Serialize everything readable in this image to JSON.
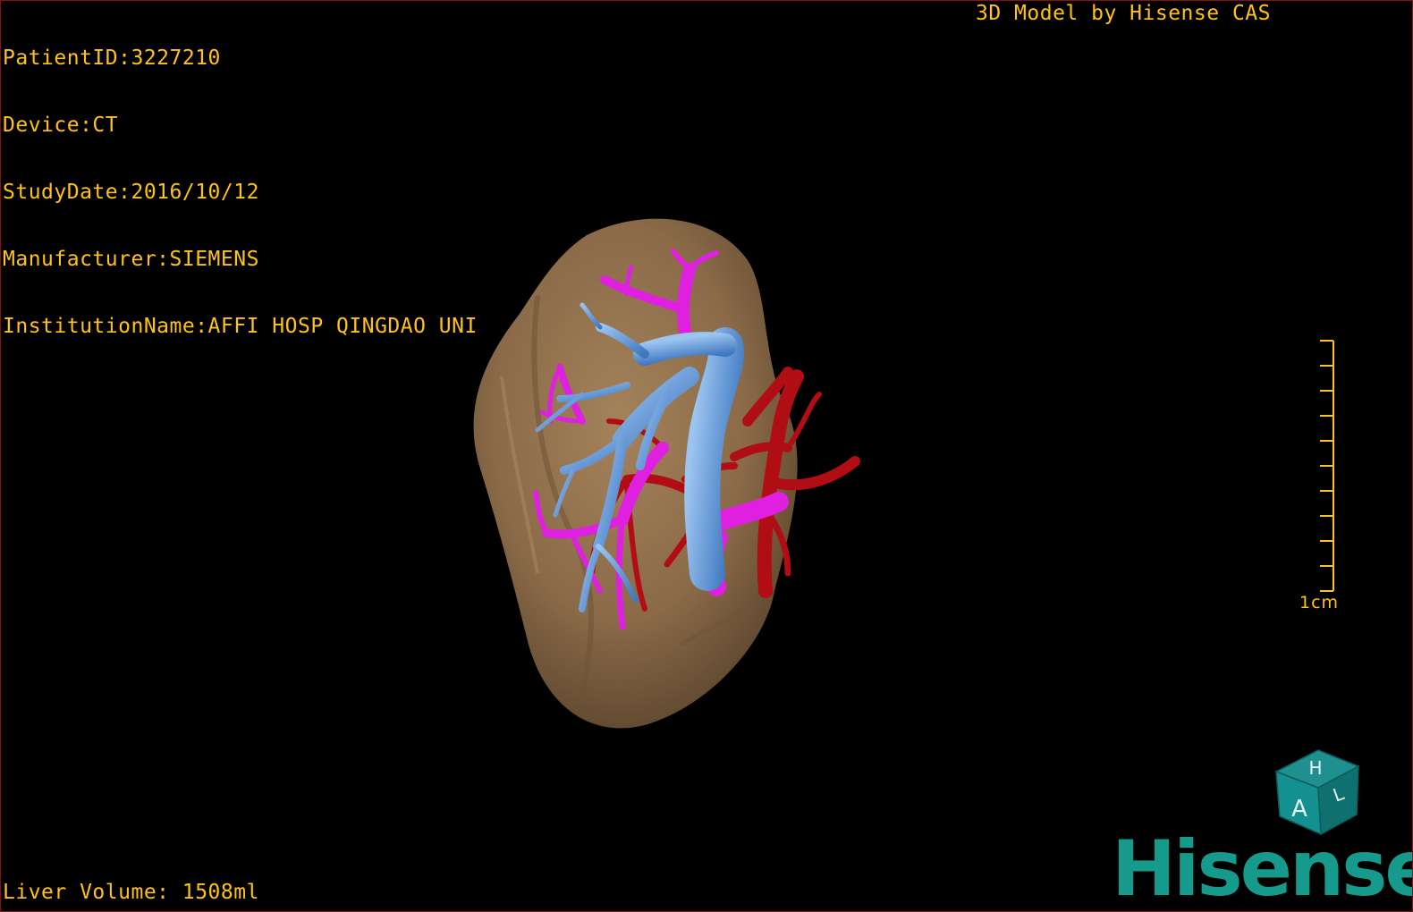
{
  "dicom": {
    "patient_id": "PatientID:3227210",
    "device": "Device:CT",
    "study_date": "StudyDate:2016/10/12",
    "manufacturer": "Manufacturer:SIEMENS",
    "institution": "InstitutionName:AFFI HOSP QINGDAO UNI"
  },
  "header": {
    "model_credit": "3D Model by Hisense CAS"
  },
  "measurement": {
    "liver_volume": "Liver Volume: 1508ml"
  },
  "scale_bar": {
    "label": "1cm"
  },
  "orientation_cube": {
    "top_face": "H",
    "front_face": "A",
    "side_face": "L"
  },
  "brand": {
    "logo_text": "Hisense"
  },
  "colors": {
    "overlay_text": "#ffc21a",
    "liver": "#8a6a48",
    "portal_vein": "#5b92d6",
    "hepatic_vein": "#e020e0",
    "hepatic_artery": "#b00d14",
    "brand": "#169a8c",
    "viewport_border": "#8a1010"
  },
  "icons": [
    "orientation-cube-icon",
    "liver-model",
    "scale-bar"
  ]
}
